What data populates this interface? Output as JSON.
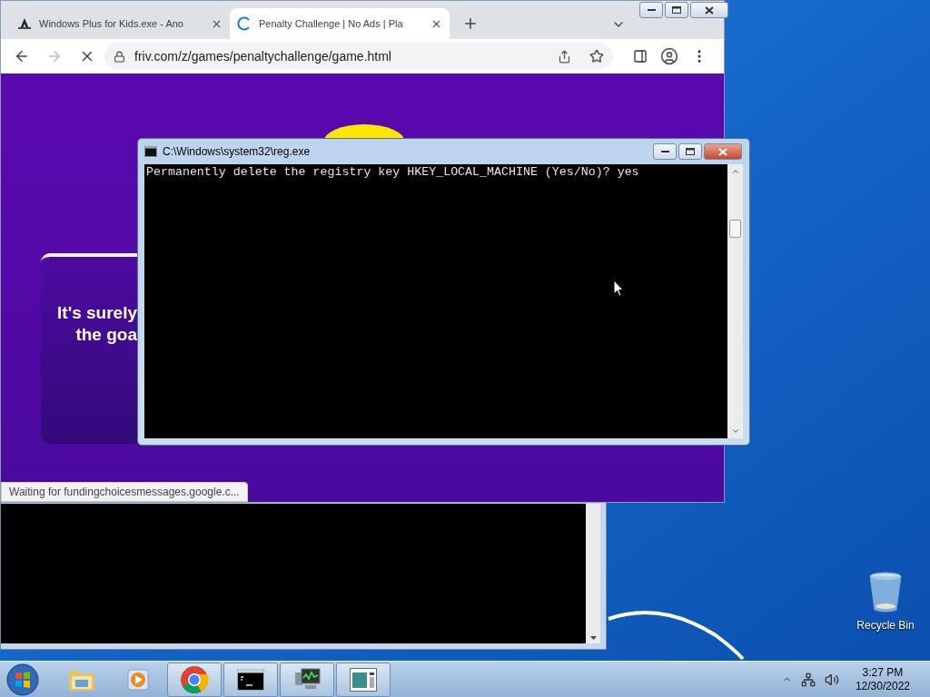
{
  "browser": {
    "tabs": [
      {
        "title": "Windows Plus for Kids.exe - Ano",
        "selected": false,
        "kind": "page"
      },
      {
        "title": "Penalty Challenge | No Ads | Pla",
        "selected": true,
        "kind": "loading"
      }
    ],
    "url": "friv.com/z/games/penaltychallenge/game.html",
    "game_card": {
      "lines": [
        "It's surely",
        "the goa"
      ]
    },
    "status": "Waiting for fundingchoicesmessages.google.c..."
  },
  "console": {
    "title": "C:\\Windows\\system32\\reg.exe",
    "lines": [
      "Permanently delete the registry key HKEY_LOCAL_MACHINE (Yes/No)? yes"
    ]
  },
  "desktop_icons": [
    {
      "label": "Recycle Bin"
    }
  ],
  "taskbar": {
    "buttons": [
      {
        "kind": "folder",
        "open": false
      },
      {
        "kind": "media",
        "open": false
      },
      {
        "kind": "chrome",
        "open": true
      },
      {
        "kind": "cmd",
        "open": true
      },
      {
        "kind": "monitor",
        "open": true
      },
      {
        "kind": "window",
        "open": true
      }
    ],
    "clock": {
      "time": "3:27 PM",
      "date": "12/30/2022"
    }
  }
}
